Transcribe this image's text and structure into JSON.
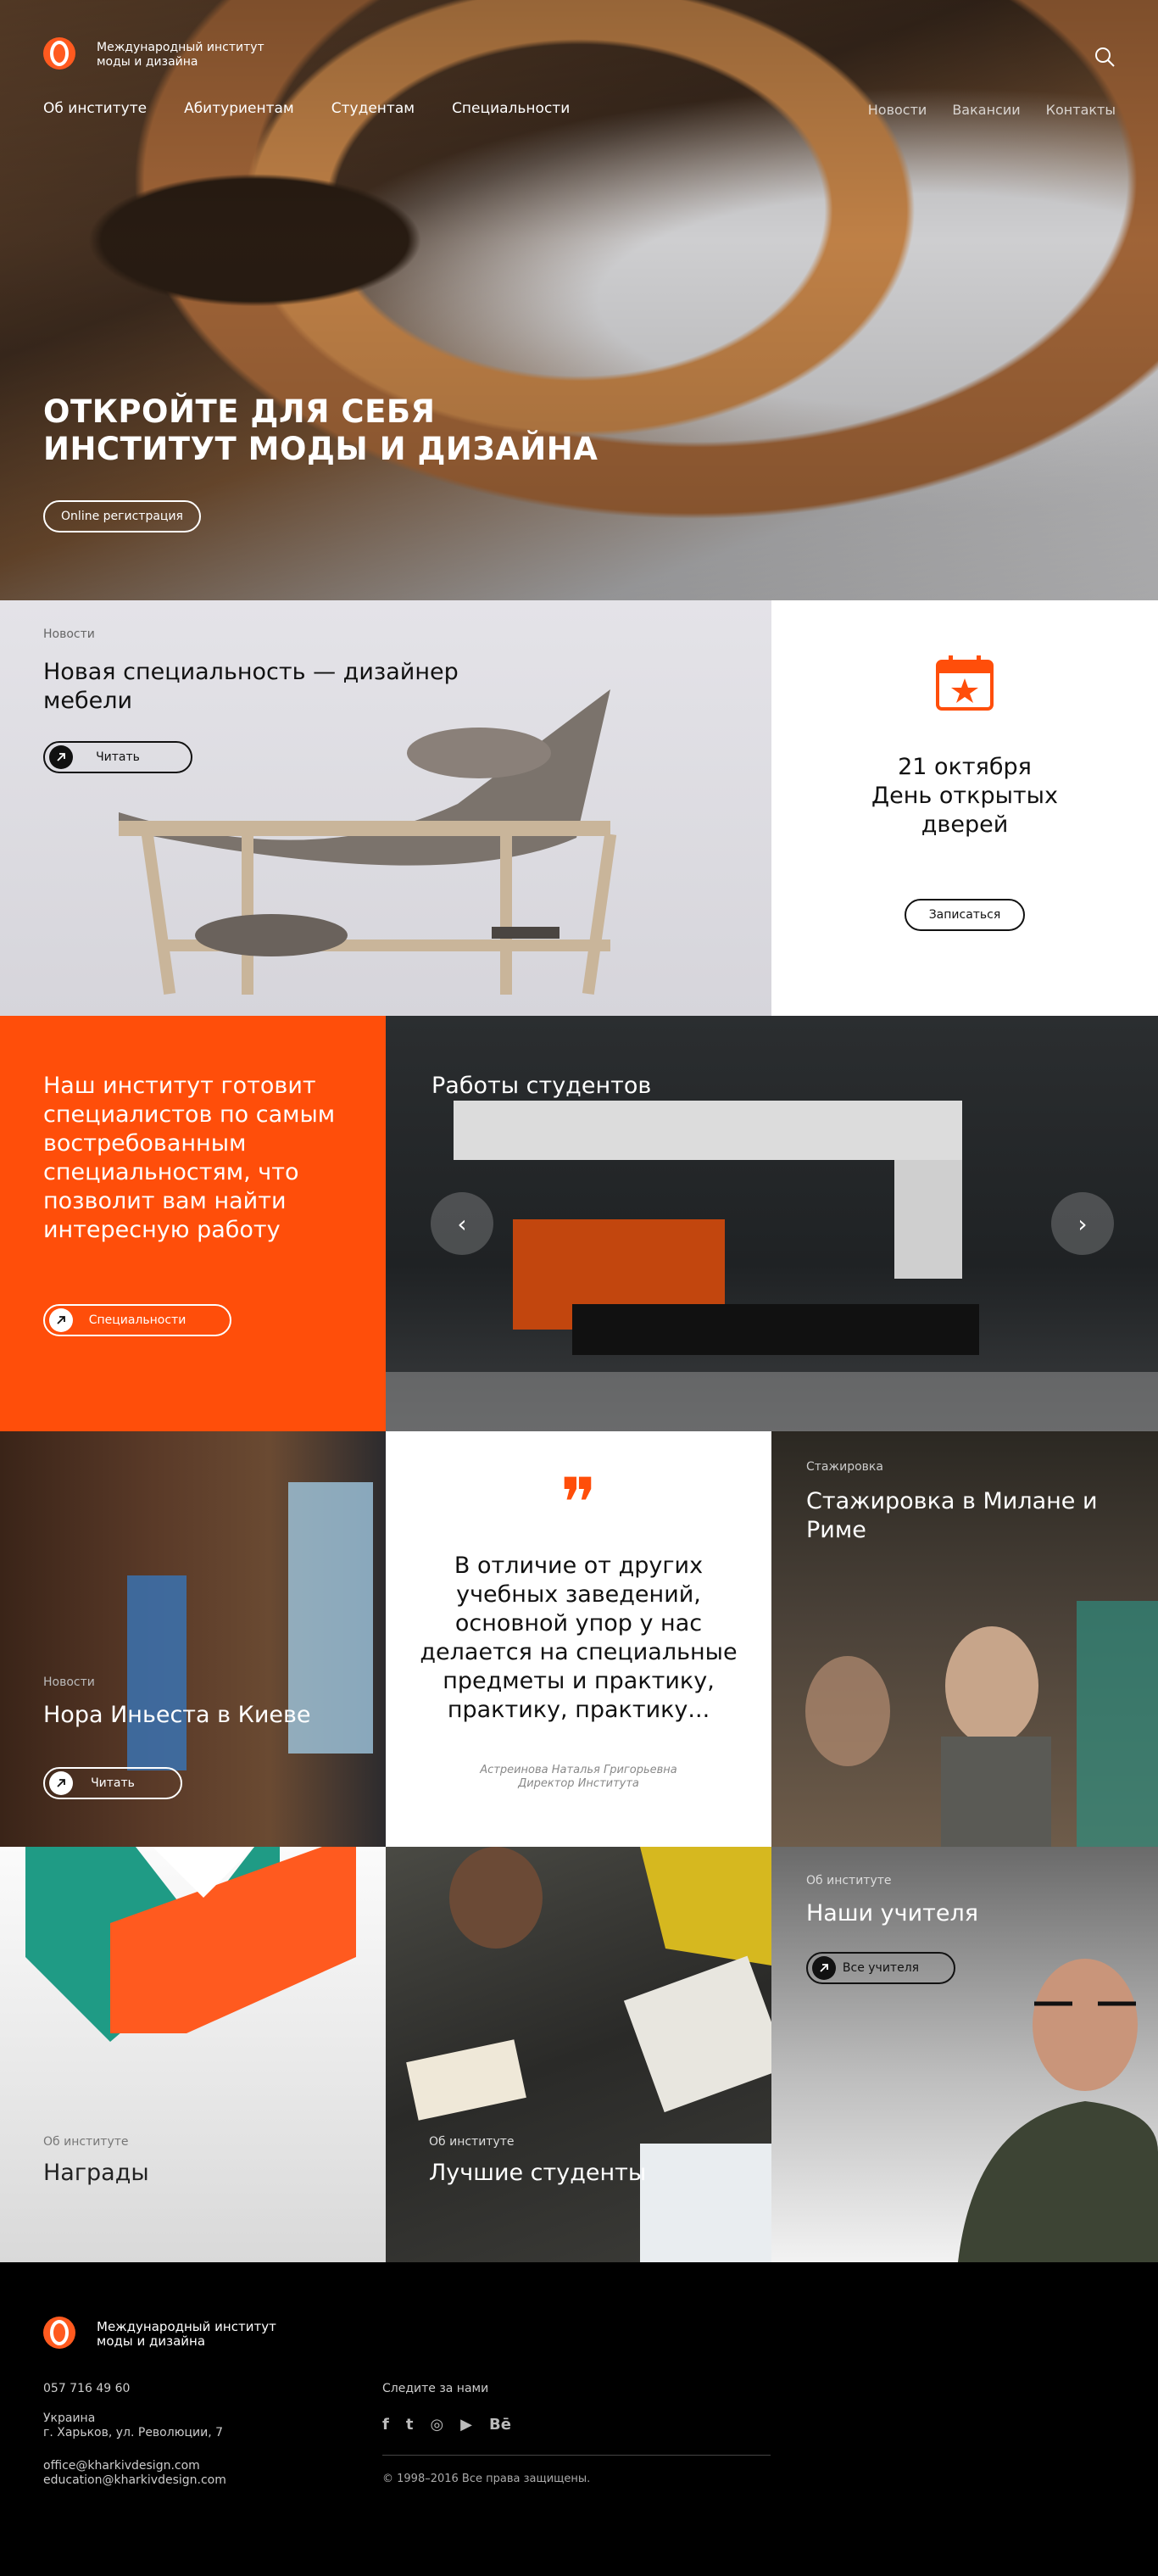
{
  "brand": {
    "name_line1": "Международный институт",
    "name_line2": "моды и дизайна"
  },
  "nav": {
    "left": [
      "Об институте",
      "Абитуриентам",
      "Студентам",
      "Специальности"
    ],
    "right": [
      "Новости",
      "Вакансии",
      "Контакты"
    ]
  },
  "hero": {
    "title_line1": "ОТКРОЙТЕ ДЛЯ СЕБЯ",
    "title_line2": "ИНСТИТУТ МОДЫ И ДИЗАЙНА",
    "cta": "Online регистрация"
  },
  "news_furniture": {
    "category": "Новости",
    "title": "Новая специальность — дизайнер мебели",
    "button": "Читать"
  },
  "open_day": {
    "date": "21 октября",
    "line2": "День открытых",
    "line3": "дверей",
    "button": "Записаться"
  },
  "specialties": {
    "text": "Наш институт готовит специалистов по самым востребованным специальностям, что позволит вам найти интересную работу",
    "button": "Специальности"
  },
  "works": {
    "title": "Работы студентов",
    "prev": "‹",
    "next": "›"
  },
  "nora": {
    "category": "Новости",
    "title": "Нора Иньеста в Киеве",
    "button": "Читать"
  },
  "quote": {
    "mark": "❞",
    "text": "В отличие от других учебных заведений, основной упор у нас делается на специальные предметы и практику, практику, практику...",
    "author_name": "Астреинова Наталья Григорьевна",
    "author_role": "Директор Института"
  },
  "internship": {
    "category": "Стажировка",
    "title": "Стажировка в Милане и Риме"
  },
  "awards": {
    "category": "Об институте",
    "title": "Награды"
  },
  "best_students": {
    "category": "Об институте",
    "title": "Лучшие студенты"
  },
  "teachers": {
    "category": "Об институте",
    "title": "Наши учителя",
    "button": "Все учителя"
  },
  "footer": {
    "phone": "057 716 49 60",
    "address_line1": "Украина",
    "address_line2": "г. Харьков, ул. Революции, 7",
    "email1": "office@kharkivdesign.com",
    "email2": "education@kharkivdesign.com",
    "follow": "Следите за нами",
    "social": [
      "f",
      "t",
      "◎",
      "▶",
      "Bē"
    ],
    "copyright": "© 1998–2016  Все права защищены."
  },
  "colors": {
    "accent": "#ff4e0a",
    "dark": "#000000"
  }
}
